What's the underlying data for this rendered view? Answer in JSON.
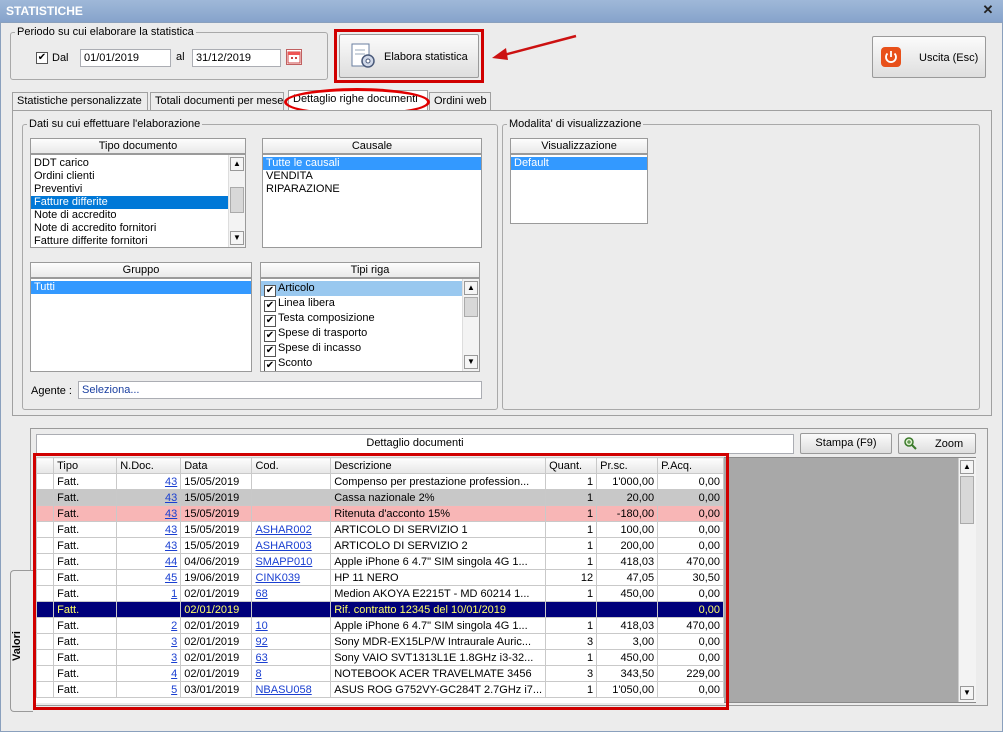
{
  "window": {
    "title": "STATISTICHE",
    "close_glyph": "✕"
  },
  "period": {
    "legend": "Periodo su cui elaborare la statistica",
    "dal_checked": true,
    "dal_label": "Dal",
    "date_from": "01/01/2019",
    "al_label": "al",
    "date_to": "31/12/2019"
  },
  "toolbar": {
    "elabora_label": "Elabora statistica",
    "uscita_label": "Uscita (Esc)"
  },
  "tabs": [
    {
      "label": "Statistiche personalizzate"
    },
    {
      "label": "Totali documenti per mese"
    },
    {
      "label": "Dettaglio righe documenti"
    },
    {
      "label": "Ordini web"
    }
  ],
  "data_section": {
    "legend": "Dati su cui effettuare l'elaborazione",
    "tipo_documento": {
      "header": "Tipo documento",
      "items": [
        "DDT carico",
        "Ordini clienti",
        "Preventivi",
        "Fatture differite",
        "Note di accredito",
        "Note di accredito fornitori",
        "Fatture differite fornitori"
      ],
      "selected": "Fatture differite"
    },
    "causale": {
      "header": "Causale",
      "items": [
        "Tutte le causali",
        "VENDITA",
        "RIPARAZIONE"
      ],
      "selected": "Tutte le causali"
    },
    "gruppo": {
      "header": "Gruppo",
      "items": [
        "Tutti"
      ],
      "selected": "Tutti"
    },
    "tipi_riga": {
      "header": "Tipi riga",
      "items": [
        "Articolo",
        "Linea libera",
        "Testa composizione",
        "Spese di trasporto",
        "Spese di incasso",
        "Sconto"
      ],
      "selected": "Articolo"
    },
    "agente_label": "Agente :",
    "agente_value": "Seleziona..."
  },
  "visualization": {
    "legend": "Modalita' di visualizzazione",
    "header": "Visualizzazione",
    "items": [
      "Default"
    ],
    "selected": "Default"
  },
  "details": {
    "title": "Dettaglio documenti",
    "stampa_label": "Stampa (F9)",
    "zoom_label": "Zoom",
    "side_tab_label": "Valori",
    "columns": [
      "Tipo",
      "N.Doc.",
      "Data",
      "Cod.",
      "Descrizione",
      "Quant.",
      "Pr.sc.",
      "P.Acq."
    ],
    "rows": [
      {
        "tipo": "Fatt.",
        "ndoc": "43",
        "data": "15/05/2019",
        "cod": "",
        "descr": "Compenso per prestazione profession...",
        "quant": "1",
        "prsc": "1'000,00",
        "pacq": "0,00",
        "style": ""
      },
      {
        "tipo": "Fatt.",
        "ndoc": "43",
        "data": "15/05/2019",
        "cod": "",
        "descr": "Cassa nazionale 2%",
        "quant": "1",
        "prsc": "20,00",
        "pacq": "0,00",
        "style": "gray"
      },
      {
        "tipo": "Fatt.",
        "ndoc": "43",
        "data": "15/05/2019",
        "cod": "",
        "descr": "Ritenuta d'acconto 15%",
        "quant": "1",
        "prsc": "-180,00",
        "pacq": "0,00",
        "style": "pink"
      },
      {
        "tipo": "Fatt.",
        "ndoc": "43",
        "data": "15/05/2019",
        "cod": "ASHAR002",
        "descr": "ARTICOLO DI SERVIZIO 1",
        "quant": "1",
        "prsc": "100,00",
        "pacq": "0,00",
        "style": ""
      },
      {
        "tipo": "Fatt.",
        "ndoc": "43",
        "data": "15/05/2019",
        "cod": "ASHAR003",
        "descr": "ARTICOLO DI SERVIZIO 2",
        "quant": "1",
        "prsc": "200,00",
        "pacq": "0,00",
        "style": ""
      },
      {
        "tipo": "Fatt.",
        "ndoc": "44",
        "data": "04/06/2019",
        "cod": "SMAPP010",
        "descr": "Apple iPhone 6 4.7\" SIM singola 4G 1...",
        "quant": "1",
        "prsc": "418,03",
        "pacq": "470,00",
        "style": ""
      },
      {
        "tipo": "Fatt.",
        "ndoc": "45",
        "data": "19/06/2019",
        "cod": "CINK039",
        "descr": "HP 11 NERO",
        "quant": "12",
        "prsc": "47,05",
        "pacq": "30,50",
        "style": ""
      },
      {
        "tipo": "Fatt.",
        "ndoc": "1",
        "data": "02/01/2019",
        "cod": "68",
        "descr": "Medion AKOYA E2215T - MD 60214 1...",
        "quant": "1",
        "prsc": "450,00",
        "pacq": "0,00",
        "style": ""
      },
      {
        "tipo": "Fatt.",
        "ndoc": "",
        "data": "02/01/2019",
        "cod": "",
        "descr": "Rif. contratto 12345 del 10/01/2019",
        "quant": "",
        "prsc": "",
        "pacq": "0,00",
        "style": "navy"
      },
      {
        "tipo": "Fatt.",
        "ndoc": "2",
        "data": "02/01/2019",
        "cod": "10",
        "descr": "Apple iPhone 6 4.7\" SIM singola 4G 1...",
        "quant": "1",
        "prsc": "418,03",
        "pacq": "470,00",
        "style": ""
      },
      {
        "tipo": "Fatt.",
        "ndoc": "3",
        "data": "02/01/2019",
        "cod": "92",
        "descr": "Sony MDR-EX15LP/W Intraurale Auric...",
        "quant": "3",
        "prsc": "3,00",
        "pacq": "0,00",
        "style": ""
      },
      {
        "tipo": "Fatt.",
        "ndoc": "3",
        "data": "02/01/2019",
        "cod": "63",
        "descr": "Sony VAIO SVT1313L1E 1.8GHz i3-32...",
        "quant": "1",
        "prsc": "450,00",
        "pacq": "0,00",
        "style": ""
      },
      {
        "tipo": "Fatt.",
        "ndoc": "4",
        "data": "02/01/2019",
        "cod": "8",
        "descr": "NOTEBOOK ACER TRAVELMATE 3456",
        "quant": "3",
        "prsc": "343,50",
        "pacq": "229,00",
        "style": ""
      },
      {
        "tipo": "Fatt.",
        "ndoc": "5",
        "data": "03/01/2019",
        "cod": "NBASU058",
        "descr": "ASUS ROG G752VY-GC284T 2.7GHz i7...",
        "quant": "1",
        "prsc": "1'050,00",
        "pacq": "0,00",
        "style": ""
      }
    ]
  }
}
